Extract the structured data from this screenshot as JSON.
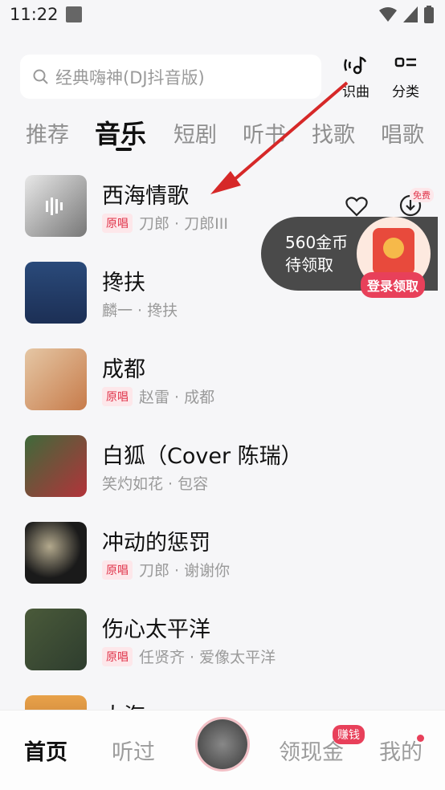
{
  "status_bar": {
    "time": "11:22"
  },
  "search": {
    "placeholder": "经典嗨神(DJ抖音版)"
  },
  "top_actions": {
    "identify": "识曲",
    "category": "分类"
  },
  "tabs": [
    "推荐",
    "音乐",
    "短剧",
    "听书",
    "找歌",
    "唱歌"
  ],
  "songs": [
    {
      "title": "西海情歌",
      "badge": "原唱",
      "meta": "刀郎 · 刀郎III"
    },
    {
      "title": "搀扶",
      "badge": "",
      "meta": "麟一 · 搀扶"
    },
    {
      "title": "成都",
      "badge": "原唱",
      "meta": "赵雷 · 成都"
    },
    {
      "title": "白狐（Cover 陈瑞）",
      "badge": "",
      "meta": "笑灼如花 · 包容"
    },
    {
      "title": "冲动的惩罚",
      "badge": "原唱",
      "meta": "刀郎 · 谢谢你"
    },
    {
      "title": "伤心太平洋",
      "badge": "原唱",
      "meta": "任贤齐 · 爱像太平洋"
    },
    {
      "title": "大海",
      "badge": "",
      "meta": ""
    }
  ],
  "promo": {
    "line1": "560金币",
    "line2": "待领取",
    "button": "登录领取",
    "free": "免费"
  },
  "bottom_nav": {
    "home": "首页",
    "listened": "听过",
    "earn": "领现金",
    "earn_badge": "赚钱",
    "me": "我的"
  },
  "colors": {
    "accent": "#e8405a",
    "arrow": "#d62828"
  }
}
